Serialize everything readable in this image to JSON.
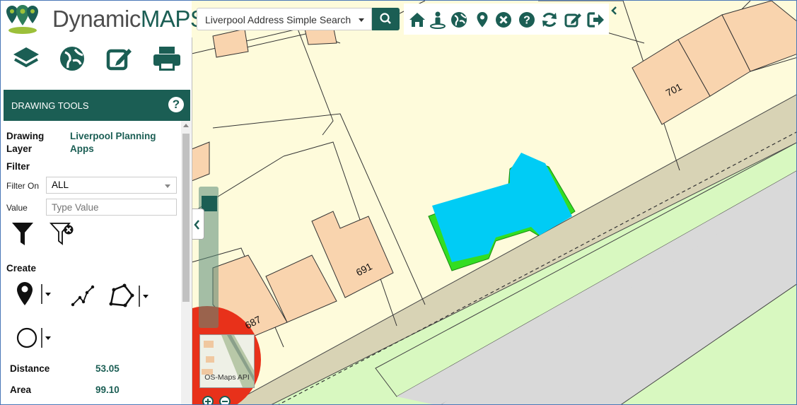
{
  "app": {
    "logo_word1": "Dynamic",
    "logo_word2": "MAPS"
  },
  "search": {
    "selected": "Liverpool Address Simple Search"
  },
  "toolbar": {
    "icons": [
      "home-icon",
      "street-view-icon",
      "globe-icon",
      "map-marker-icon",
      "clear-icon",
      "help-icon",
      "refresh-icon",
      "edit-icon",
      "logout-icon",
      "collapse-chevron-icon"
    ]
  },
  "panel": {
    "nav_icons": [
      "layers-icon",
      "globe-icon",
      "edit-icon",
      "print-icon"
    ],
    "drawing_tools": {
      "title": "DRAWING TOOLS",
      "help": "?",
      "drawing_layer_label": "Drawing\nLayer",
      "drawing_layer_value": "Liverpool Planning Apps",
      "filter_heading": "Filter",
      "filter_on_label": "Filter On",
      "filter_on_value": "ALL",
      "value_label": "Value",
      "value_placeholder": "Type Value",
      "create_heading": "Create",
      "distance_label": "Distance",
      "distance_value": "53.05",
      "area_label": "Area",
      "area_value": "99.10"
    }
  },
  "map": {
    "plot_labels": [
      "701",
      "691",
      "687"
    ],
    "basemap_label": "OS-Maps API",
    "colors": {
      "building": "#f9d4ae",
      "land": "#fefbdb",
      "pavement": "#d8d3b5",
      "road": "#d9d9d9",
      "verge": "#d8f8c0",
      "drawn_shape": "#00ccf5",
      "drawn_shape_outline": "#33dd22",
      "brand": "#1b5e54"
    }
  }
}
